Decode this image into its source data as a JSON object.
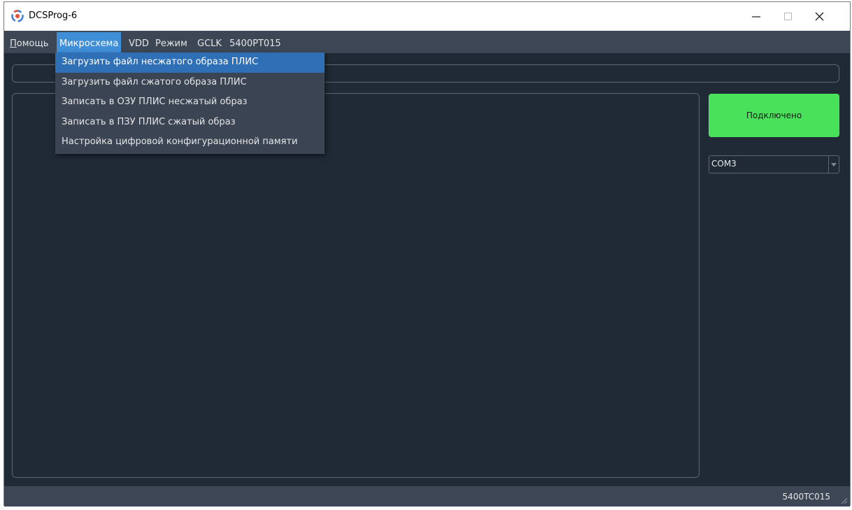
{
  "window": {
    "title": "DCSProg-6"
  },
  "menubar": {
    "items": [
      "Помощь",
      "Микросхема",
      "VDD",
      "Режим",
      "GCLK",
      "5400РТ015"
    ]
  },
  "dropdown": {
    "items": [
      "Загрузить файл несжатого образа ПЛИС",
      "Загрузить файл сжатого образа ПЛИС",
      "Записать в ОЗУ ПЛИС несжатый образ",
      "Записать в ПЗУ ПЛИС сжатый образ",
      "Настройка цифровой конфигурационной памяти"
    ]
  },
  "connect": {
    "label": "Подключено",
    "color": "#49e15a"
  },
  "port": {
    "value": "COM3"
  },
  "status": {
    "text": "5400TC015"
  },
  "colors": {
    "accent": "#3f8fd8",
    "highlight": "#2f6fb6",
    "background": "#1f2a36"
  }
}
